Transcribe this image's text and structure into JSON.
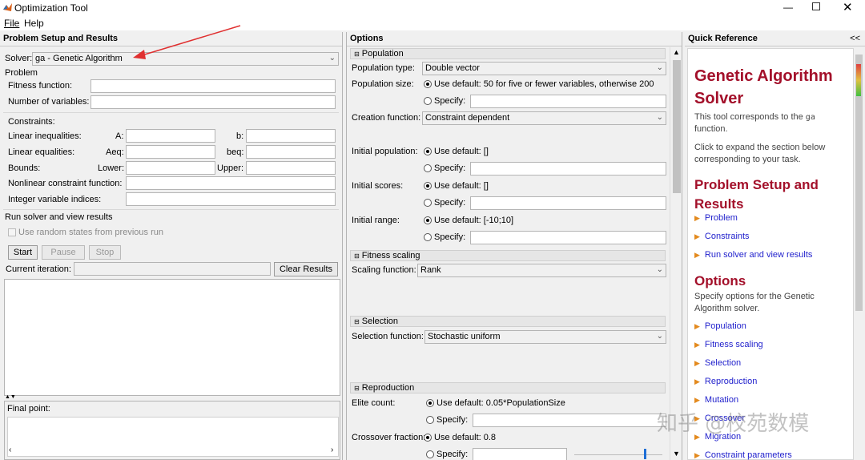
{
  "window": {
    "title": "Optimization Tool"
  },
  "menu": {
    "file": "File",
    "help": "Help"
  },
  "left": {
    "header": "Problem Setup and Results",
    "solver_label": "Solver:",
    "solver_value": "ga - Genetic Algorithm",
    "problem_label": "Problem",
    "fitness_label": "Fitness function:",
    "numvars_label": "Number of variables:",
    "constraints_label": "Constraints:",
    "lin_ineq_label": "Linear inequalities:",
    "a_label": "A:",
    "b_label": "b:",
    "lin_eq_label": "Linear equalities:",
    "aeq_label": "Aeq:",
    "beq_label": "beq:",
    "bounds_label": "Bounds:",
    "lower_label": "Lower:",
    "upper_label": "Upper:",
    "nonlin_label": "Nonlinear constraint function:",
    "intvar_label": "Integer variable indices:",
    "run_label": "Run solver and view results",
    "random_states_label": "Use random states from previous run",
    "start": "Start",
    "pause": "Pause",
    "stop": "Stop",
    "current_iter_label": "Current iteration:",
    "clear_results": "Clear Results",
    "final_point_label": "Final point:"
  },
  "options": {
    "header": "Options",
    "population": {
      "title": "Population",
      "type_label": "Population type:",
      "type_value": "Double vector",
      "size_label": "Population size:",
      "size_default": "Use default: 50 for five or fewer variables, otherwise 200",
      "specify": "Specify:",
      "creation_label": "Creation function:",
      "creation_value": "Constraint dependent",
      "init_pop_label": "Initial population:",
      "init_pop_default": "Use default: []",
      "init_scores_label": "Initial scores:",
      "init_scores_default": "Use default: []",
      "init_range_label": "Initial range:",
      "init_range_default": "Use default: [-10;10]"
    },
    "fitness_scaling": {
      "title": "Fitness scaling",
      "label": "Scaling function:",
      "value": "Rank"
    },
    "selection": {
      "title": "Selection",
      "label": "Selection function:",
      "value": "Stochastic uniform"
    },
    "reproduction": {
      "title": "Reproduction",
      "elite_label": "Elite count:",
      "elite_default": "Use default: 0.05*PopulationSize",
      "crossover_label": "Crossover fraction:",
      "crossover_default": "Use default: 0.8",
      "specify": "Specify:"
    }
  },
  "quickref": {
    "header": "Quick Reference",
    "collapse": "<<",
    "title": "Genetic Algorithm Solver",
    "intro_1a": "This tool corresponds to the ",
    "intro_1b": "ga",
    "intro_1c": "function.",
    "intro_2": "Click to expand the section below corresponding to your task.",
    "section1_title": "Problem Setup and Results",
    "section1_links": [
      "Problem",
      "Constraints",
      "Run solver and view results"
    ],
    "section2_title": "Options",
    "section2_desc": "Specify options for the Genetic Algorithm solver.",
    "section2_links": [
      "Population",
      "Fitness scaling",
      "Selection",
      "Reproduction",
      "Mutation",
      "Crossover",
      "Migration",
      "Constraint parameters"
    ]
  },
  "watermark": "知乎 @校苑数模",
  "colors": {
    "qr_heading": "#a3102a",
    "qr_link": "#1f1fcc",
    "bullet": "#e38a1e",
    "annotation_arrow": "#e03030"
  }
}
